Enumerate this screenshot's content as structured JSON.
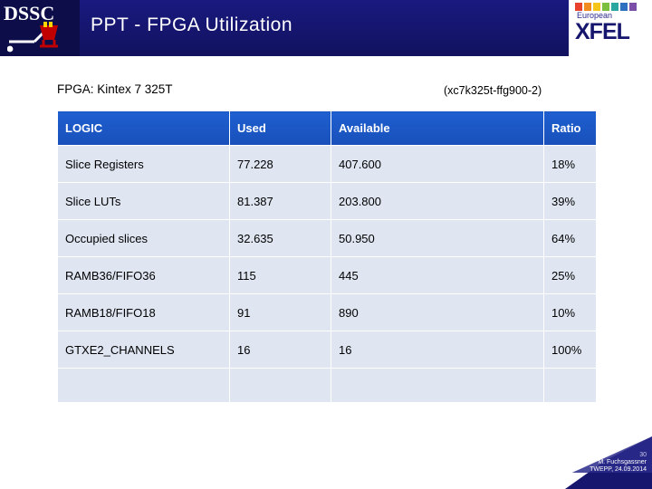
{
  "header": {
    "logo_left_text": "DSSC",
    "title": "PPT - FPGA Utilization",
    "logo_right_top": "European",
    "logo_right_main": "XFEL"
  },
  "slide": {
    "fpga_label": "FPGA: Kintex 7 325T",
    "part_label": "(xc7k325t-ffg900-2)"
  },
  "table": {
    "columns": [
      "LOGIC",
      "Used",
      "Available",
      "Ratio"
    ],
    "rows": [
      [
        "Slice Registers",
        "77.228",
        "407.600",
        "18%"
      ],
      [
        "Slice LUTs",
        "81.387",
        "203.800",
        "39%"
      ],
      [
        "Occupied slices",
        "32.635",
        "50.950",
        "64%"
      ],
      [
        "RAMB36/FIFO36",
        "115",
        "445",
        "25%"
      ],
      [
        "RAMB18/FIFO18",
        "91",
        "890",
        "10%"
      ],
      [
        "GTXE2_CHANNELS",
        "16",
        "16",
        "100%"
      ],
      [
        "",
        "",
        "",
        ""
      ]
    ]
  },
  "footer": {
    "page_number": "30",
    "author": "M. Fuchsgassner",
    "event": "TWEPP, 24.09.2014"
  },
  "colors": {
    "header_bg": "#16166e",
    "table_header_bg": "#1a56c4",
    "table_cell_bg": "#dfe6f2",
    "accent_red": "#c00000",
    "accent_yellow": "#ffd400"
  }
}
